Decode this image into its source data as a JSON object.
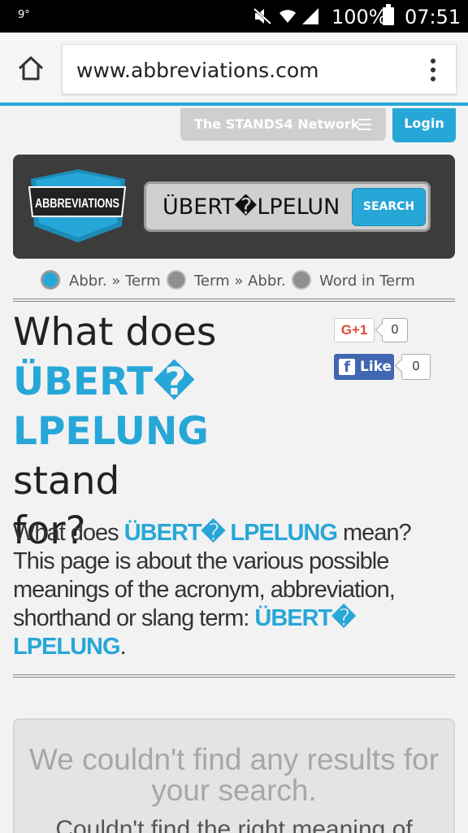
{
  "status_bar": {
    "temperature": "9°",
    "battery_percent": "100%",
    "time": "07:51"
  },
  "browser": {
    "url": "www.abbreviations.com"
  },
  "network": {
    "label": "The STANDS4 Network",
    "login_label": "Login"
  },
  "header": {
    "logo_text": "ABBREVIATIONS",
    "search_value": "ÜBERT�LPELUN",
    "search_button": "SEARCH"
  },
  "search_modes": [
    {
      "label": "Abbr. » Term",
      "selected": true
    },
    {
      "label": "Term » Abbr.",
      "selected": false
    },
    {
      "label": "Word in Term",
      "selected": false
    }
  ],
  "headline": {
    "prefix": "What does",
    "term_line1": "ÜBERT�",
    "term_line2": "LPELUNG",
    "suffix_stand": "stand",
    "suffix_for": "for?"
  },
  "social": {
    "gplus_label": "G+1",
    "gplus_count": "0",
    "fb_label": "Like",
    "fb_count": "0"
  },
  "intro": {
    "part1": "What does ",
    "term_a": "ÜBERT� LPELUNG",
    "part2": " mean? This page is about the various possible meanings of the acronym, abbreviation, shorthand or slang term: ",
    "term_b": "ÜBERT� LPELUNG",
    "part3": "."
  },
  "results": {
    "title": "We couldn't find any results for your search.",
    "subtitle": "Couldn't find the right meaning of"
  },
  "colors": {
    "accent": "#27a7d8",
    "header_bg": "#3c3c3c",
    "page_bg": "#f2f2f2"
  }
}
